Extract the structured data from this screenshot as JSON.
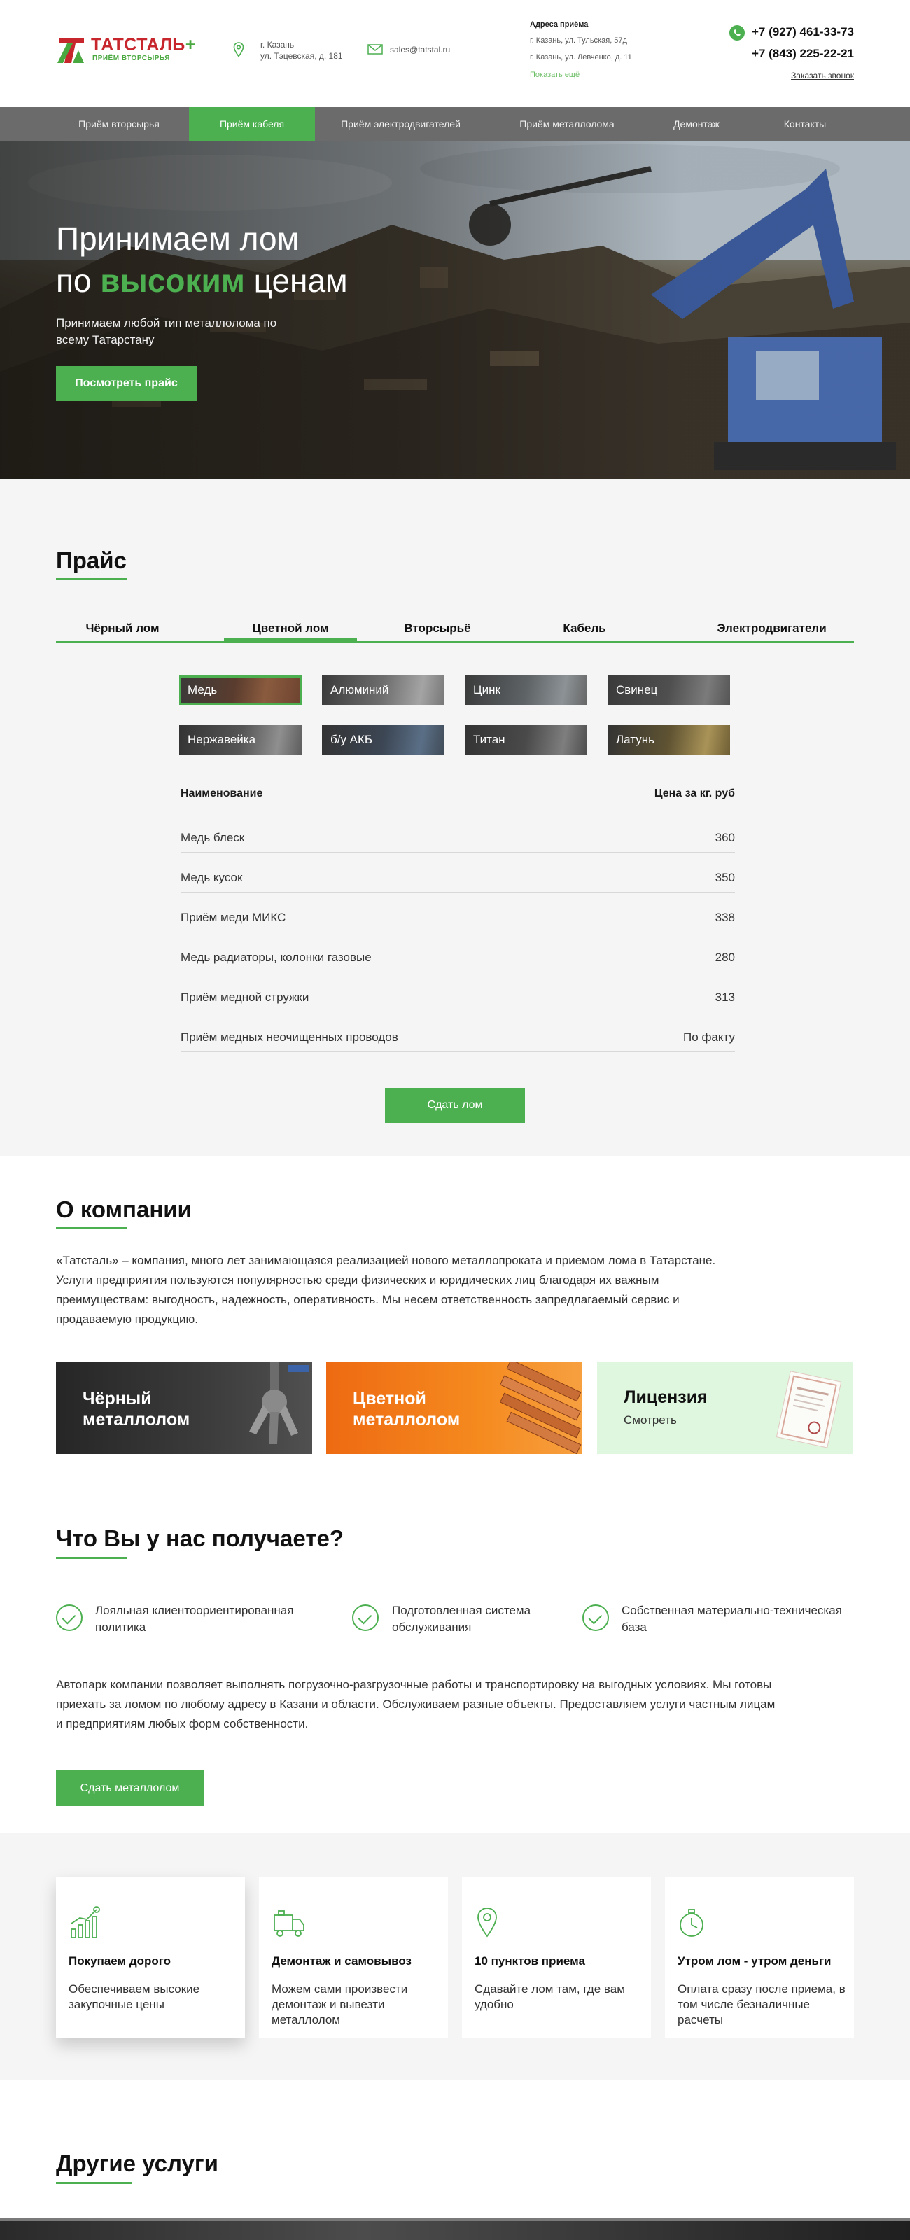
{
  "header": {
    "logo_name": "ТАТСТАЛЬ",
    "logo_plus": "+",
    "logo_sub": "ПРИЁМ ВТОРСЫРЬЯ",
    "city": "г. Казань",
    "street": "ул. Тэцевская, д. 181",
    "email": "sales@tatstal.ru",
    "addresses_title": "Адреса приёма",
    "address_1": "г. Казань, ул. Тульская, 57д",
    "address_2": "г. Казань, ул. Левченко, д. 11",
    "show_map": "Показать ещё",
    "phone_1": "+7 (927) 461-33-73",
    "phone_2": "+7 (843) 225-22-21",
    "callback": "Заказать звонок"
  },
  "nav": {
    "items": [
      {
        "label": "Приём вторсырья"
      },
      {
        "label": "Приём кабеля"
      },
      {
        "label": "Приём электродвигателей"
      },
      {
        "label": "Приём металлолома"
      },
      {
        "label": "Демонтаж"
      },
      {
        "label": "Контакты"
      }
    ],
    "active_index": 1
  },
  "hero": {
    "title_line1": "Принимаем лом",
    "title_pre": "по ",
    "title_green": "высоким",
    "title_post": " ценам",
    "subtitle": "Принимаем любой тип металлолома по всему Татарстану",
    "button": "Посмотреть прайс"
  },
  "price": {
    "title": "Прайс",
    "tabs": [
      "Чёрный лом",
      "Цветной лом",
      "Вторсырьё",
      "Кабель",
      "Электродвигатели"
    ],
    "active_tab": 1,
    "metals": [
      "Медь",
      "Алюминий",
      "Цинк",
      "Свинец",
      "Нержавейка",
      "б/у АКБ",
      "Титан",
      "Латунь"
    ],
    "selected_metal": 0,
    "col_name": "Наименование",
    "col_price": "Цена за кг. руб",
    "rows": [
      {
        "name": "Медь блеск",
        "price": "360"
      },
      {
        "name": "Медь кусок",
        "price": "350"
      },
      {
        "name": "Приём меди МИКС",
        "price": "338"
      },
      {
        "name": "Медь радиаторы, колонки газовые",
        "price": "280"
      },
      {
        "name": "Приём медной стружки",
        "price": "313"
      },
      {
        "name": "Приём медных неочищенных проводов",
        "price": "По факту"
      }
    ],
    "button": "Сдать лом"
  },
  "about": {
    "title": "О компании",
    "text": "«Татсталь» – компания, много лет занимающаяся реализацией нового металлопроката и приемом лома в Татарстане. Услуги предприятия пользуются популярностью среди физических и юридических лиц благодаря их важным преимуществам: выгодность, надежность, оперативность. Мы несем ответственность запредлагаемый сервис и продаваемую продукцию.",
    "card_black_1": "Чёрный",
    "card_black_2": "металлолом",
    "card_color_1": "Цветной",
    "card_color_2": "металлолом",
    "card_license": "Лицензия",
    "card_license_link": "Смотреть"
  },
  "get": {
    "title": "Что Вы у нас получаете?",
    "items": [
      "Лояльная клиентоориентированная политика",
      "Подготовленная система обслуживания",
      "Собственная материально-техническая база"
    ],
    "fleet": "Автопарк компании позволяет выполнять погрузочно-разгрузочные работы и транспортировку на выгодных условиях. Мы готовы приехать за ломом по любому адресу в Казани и области. Обслуживаем разные объекты. Предоставляем услуги частным лицам и предприятиям любых форм собственности.",
    "button": "Сдать металлолом"
  },
  "features": [
    {
      "title": "Покупаем дорого",
      "desc": "Обеспечиваем высокие закупочные цены"
    },
    {
      "title": "Демонтаж и самовывоз",
      "desc": "Можем сами произвести демонтаж и вывезти металлолом"
    },
    {
      "title": "10 пунктов приема",
      "desc": "Сдавайте лом там, где вам удобно"
    },
    {
      "title": "Утром лом - утром деньги",
      "desc": "Оплата сразу после приема, в том числе безналичные расчеты"
    }
  ],
  "other": {
    "title": "Другие услуги"
  },
  "colors": {
    "accent": "#4caf50",
    "nav_bg": "#6b6b6b",
    "brand_red": "#c6262c"
  }
}
